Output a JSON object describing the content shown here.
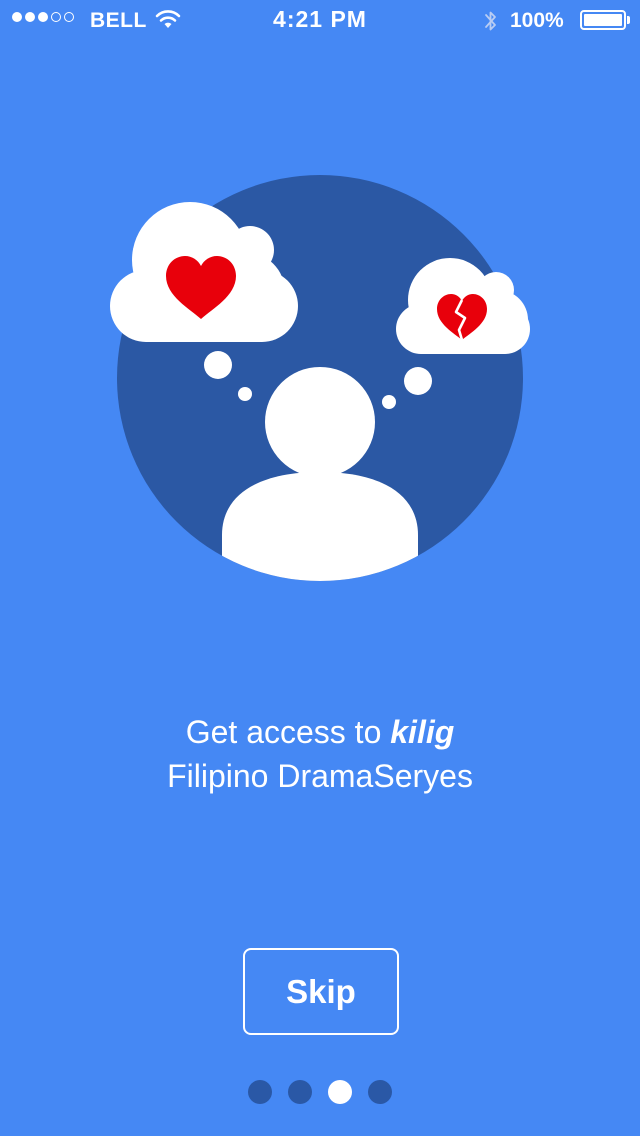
{
  "status_bar": {
    "signal_bars_filled": 3,
    "signal_bars_total": 5,
    "carrier": "BELL",
    "time": "4:21 PM",
    "battery_percent": "100%",
    "battery_level": 1.0,
    "icons": [
      "signal-dots-icon",
      "wifi-icon",
      "bluetooth-icon",
      "battery-icon"
    ]
  },
  "illustration": {
    "icons": [
      "person-icon",
      "thought-cloud-heart-icon",
      "thought-cloud-broken-heart-icon"
    ],
    "colors": {
      "circle": "#2b58a4",
      "heart": "#e8000b",
      "cloud": "#ffffff"
    }
  },
  "tagline": {
    "line1_prefix": "Get access to ",
    "line1_emphasis": "kilig",
    "line2": "Filipino DramaSeryes"
  },
  "skip_button": {
    "label": "Skip"
  },
  "pager": {
    "total": 4,
    "current": 3
  },
  "colors": {
    "background": "#4588f4",
    "dot_inactive": "#2a58a6",
    "dot_active": "#ffffff"
  }
}
